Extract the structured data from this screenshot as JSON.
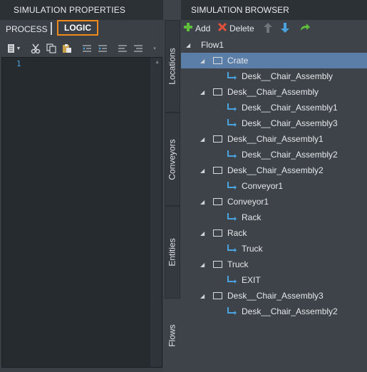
{
  "left": {
    "title": "SIMULATION PROPERTIES",
    "tabs": {
      "process": "PROCESS",
      "logic": "LOGIC"
    },
    "editor": {
      "line_number": "1"
    }
  },
  "vertical_tabs": [
    "Locations",
    "Conveyors",
    "Entities",
    "Flows"
  ],
  "right": {
    "title": "SIMULATION BROWSER",
    "toolbar": {
      "add": "Add",
      "delete": "Delete"
    },
    "tree": {
      "root": "Flow1",
      "nodes": [
        {
          "label": "Crate",
          "child": "Desk__Chair_Assembly"
        },
        {
          "label": "Desk__Chair_Assembly",
          "children": [
            "Desk__Chair_Assembly1",
            "Desk__Chair_Assembly3"
          ]
        },
        {
          "label": "Desk__Chair_Assembly1",
          "child": "Desk__Chair_Assembly2"
        },
        {
          "label": "Desk__Chair_Assembly2",
          "child": "Conveyor1"
        },
        {
          "label": "Conveyor1",
          "child": "Rack"
        },
        {
          "label": "Rack",
          "child": "Truck"
        },
        {
          "label": "Truck",
          "child": "EXIT"
        },
        {
          "label": "Desk__Chair_Assembly3",
          "child": "Desk__Chair_Assembly2"
        }
      ]
    }
  },
  "colors": {
    "accent_orange": "#f08a1c",
    "selection": "#5b7ea8",
    "link_blue": "#4aa3df"
  }
}
